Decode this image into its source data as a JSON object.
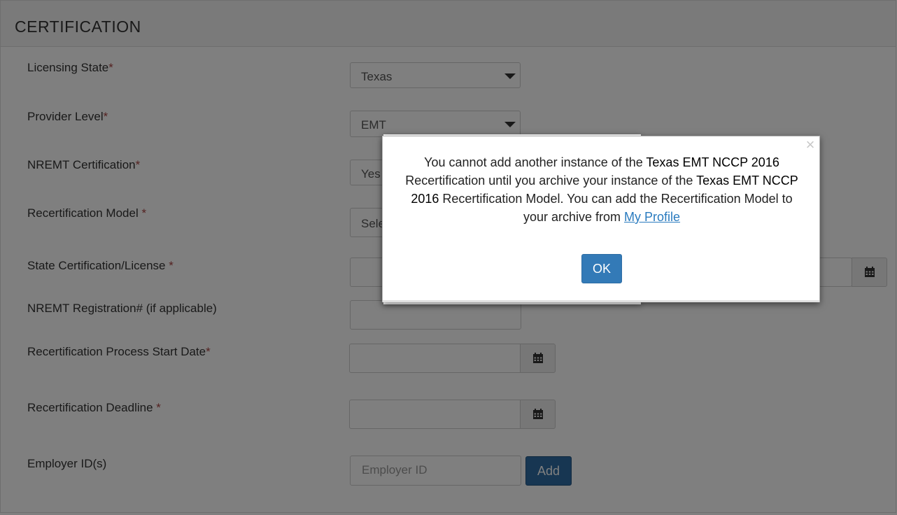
{
  "section": {
    "title": "CERTIFICATION"
  },
  "fields": {
    "licensing_state": {
      "label": "Licensing State",
      "required": "*",
      "value": "Texas"
    },
    "provider_level": {
      "label": "Provider Level",
      "required": "*",
      "value": "EMT"
    },
    "nremt_certification": {
      "label": "NREMT Certification",
      "required": "*",
      "value": "Yes"
    },
    "recertification_model": {
      "label": "Recertification Model ",
      "required": "*",
      "value": "Sele"
    },
    "state_certification": {
      "label": "State Certification/License ",
      "required": "*"
    },
    "nremt_registration": {
      "label": "NREMT Registration# (if applicable)"
    },
    "process_start_date": {
      "label": "Recertification Process Start Date",
      "required": "*"
    },
    "deadline": {
      "label": "Recertification Deadline ",
      "required": "*"
    },
    "employer_ids": {
      "label": "Employer ID(s)",
      "placeholder": "Employer ID",
      "add_label": "Add"
    }
  },
  "modal": {
    "close": "×",
    "text_1": "You cannot add another instance of the ",
    "bold_1": "Texas EMT NCCP 2016",
    "text_2": " Recertification until you archive your instance of the ",
    "bold_2": "Texas EMT NCCP 2016",
    "text_3": " Recertification Model. You can add the Recertification Model to your archive from ",
    "link": "My Profile",
    "ok_label": "OK"
  },
  "icons": {
    "calendar": "calendar-icon",
    "dropdown": "chevron-down-icon",
    "close": "close-icon"
  },
  "colors": {
    "primary": "#337ab7",
    "required": "#a94442",
    "link": "#2a7bbf"
  }
}
